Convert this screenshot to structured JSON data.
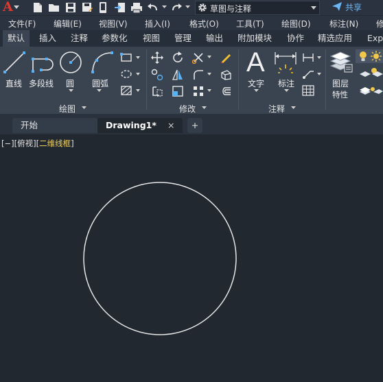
{
  "title_bar": {
    "app_logo": "A",
    "workspace": "草图与注释",
    "share_label": "共享"
  },
  "menu_bar": {
    "items": [
      "文件(F)",
      "编辑(E)",
      "视图(V)",
      "插入(I)",
      "格式(O)",
      "工具(T)",
      "绘图(D)",
      "标注(N)",
      "修"
    ]
  },
  "ribbon_tabs": {
    "items": [
      "默认",
      "插入",
      "注释",
      "参数化",
      "视图",
      "管理",
      "输出",
      "附加模块",
      "协作",
      "精选应用",
      "Exp"
    ],
    "active": "默认"
  },
  "ribbon": {
    "draw": {
      "line": "直线",
      "polyline": "多段线",
      "circle": "圆",
      "arc": "圆弧",
      "panel_label": "绘图"
    },
    "modify": {
      "panel_label": "修改"
    },
    "annotation": {
      "text": "文字",
      "dimension": "标注",
      "panel_label": "注释"
    },
    "layers": {
      "line1": "图层",
      "line2": "特性"
    }
  },
  "doc_tabs": {
    "start": "开始",
    "active": "Drawing1*",
    "close": "×",
    "add": "+"
  },
  "viewport": {
    "prefix": "[−][俯视][",
    "style": "二维线框",
    "suffix": "]"
  },
  "colors": {
    "canvas": "#212830",
    "ribbon": "#3a4350",
    "logo_red": "#e03a2f",
    "share_blue": "#6cb6f5",
    "viewstyle_yellow": "#f0d060",
    "circle": "#e8e8e8"
  }
}
